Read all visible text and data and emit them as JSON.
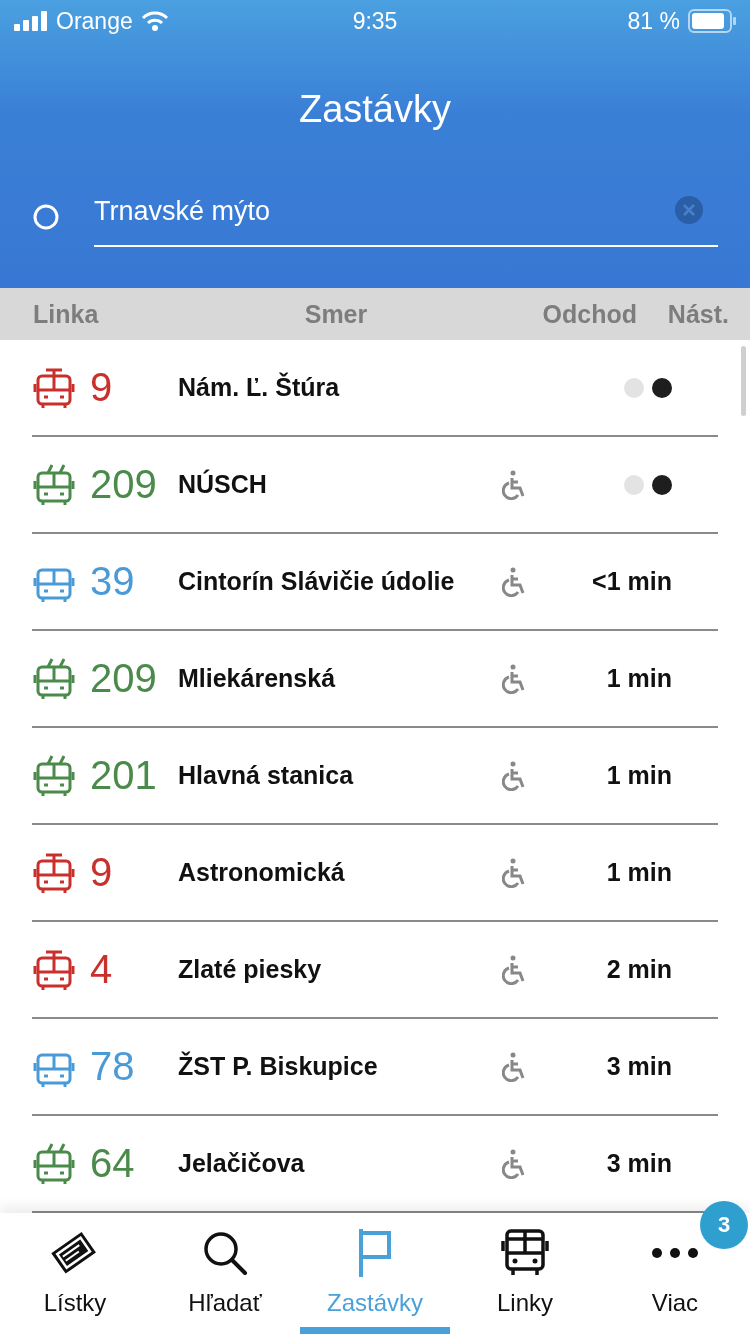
{
  "status_bar": {
    "carrier": "Orange",
    "time": "9:35",
    "battery": "81 %"
  },
  "header": {
    "title": "Zastávky",
    "search": {
      "value": "Trnavské mýto"
    }
  },
  "columns": [
    "Linka",
    "Smer",
    "Odchod",
    "Nást."
  ],
  "departures": [
    {
      "kind": "tram",
      "color": "#c9302c",
      "line": "9",
      "direction": "Nám. Ľ. Štúra",
      "accessible": false,
      "live": true
    },
    {
      "kind": "trolleybus",
      "color": "#4a8a4a",
      "line": "209",
      "direction": "NÚSCH",
      "accessible": true,
      "live": true
    },
    {
      "kind": "bus",
      "color": "#4a9ad8",
      "line": "39",
      "direction": "Cintorín Slávičie údolie",
      "accessible": true,
      "live": false,
      "departure": "<1 min"
    },
    {
      "kind": "trolleybus",
      "color": "#4a8a4a",
      "line": "209",
      "direction": "Mliekárenská",
      "accessible": true,
      "live": false,
      "departure": "1 min"
    },
    {
      "kind": "trolleybus",
      "color": "#4a8a4a",
      "line": "201",
      "direction": "Hlavná stanica",
      "accessible": true,
      "live": false,
      "departure": "1 min"
    },
    {
      "kind": "tram",
      "color": "#c9302c",
      "line": "9",
      "direction": "Astronomická",
      "accessible": true,
      "live": false,
      "departure": "1 min"
    },
    {
      "kind": "tram",
      "color": "#c9302c",
      "line": "4",
      "direction": "Zlaté piesky",
      "accessible": true,
      "live": false,
      "departure": "2 min"
    },
    {
      "kind": "bus",
      "color": "#4a9ad8",
      "line": "78",
      "direction": "ŽST P. Biskupice",
      "accessible": true,
      "live": false,
      "departure": "3 min"
    },
    {
      "kind": "trolleybus",
      "color": "#4a8a4a",
      "line": "64",
      "direction": "Jelačičova",
      "accessible": true,
      "live": false,
      "departure": "3 min"
    }
  ],
  "tabs": [
    {
      "kind": "tickets",
      "label": "Lístky",
      "selected": false
    },
    {
      "kind": "search",
      "label": "Hľadať",
      "selected": false
    },
    {
      "kind": "stops",
      "label": "Zastávky",
      "selected": true
    },
    {
      "kind": "lines",
      "label": "Linky",
      "selected": false
    },
    {
      "kind": "more",
      "label": "Viac",
      "selected": false,
      "badge": "3"
    }
  ]
}
